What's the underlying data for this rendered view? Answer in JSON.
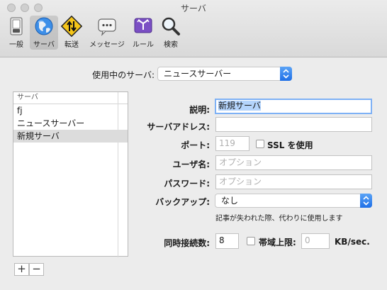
{
  "window": {
    "title": "サーバ"
  },
  "toolbar": {
    "items": [
      {
        "label": "一般",
        "icon": "general-switch-icon"
      },
      {
        "label": "サーバ",
        "icon": "globe-icon",
        "selected": true
      },
      {
        "label": "転送",
        "icon": "transfer-sign-icon"
      },
      {
        "label": "メッセージ",
        "icon": "speech-bubble-icon"
      },
      {
        "label": "ルール",
        "icon": "rules-icon"
      },
      {
        "label": "検索",
        "icon": "magnifier-icon"
      }
    ]
  },
  "server_chooser": {
    "label": "使用中のサーバ:",
    "value": "ニュースサーバー"
  },
  "server_list": {
    "header": "サーバ",
    "items": [
      "fj",
      "ニュースサーバー",
      "新規サーバ"
    ],
    "selected_index": 2,
    "add_label": "+",
    "remove_label": "−"
  },
  "form": {
    "description": {
      "label": "説明:",
      "value": "新規サーバ"
    },
    "server_address": {
      "label": "サーバアドレス:",
      "value": ""
    },
    "port": {
      "label": "ポート:",
      "placeholder": "119"
    },
    "ssl": {
      "label": "SSL を使用",
      "checked": false
    },
    "username": {
      "label": "ユーザ名:",
      "placeholder": "オプション"
    },
    "password": {
      "label": "パスワード:",
      "placeholder": "オプション"
    },
    "backup": {
      "label": "バックアップ:",
      "value": "なし"
    },
    "backup_note": "記事が失われた際、代わりに使用します",
    "connections": {
      "label": "同時接続数:",
      "value": "8"
    },
    "bandwidth": {
      "label": "帯域上限:",
      "checked": false,
      "value": "0",
      "unit": "KB/sec."
    }
  },
  "colors": {
    "accent": "#2a7ae8",
    "selection": "#b4d4fc",
    "focus_ring": "#7eb1f5"
  }
}
